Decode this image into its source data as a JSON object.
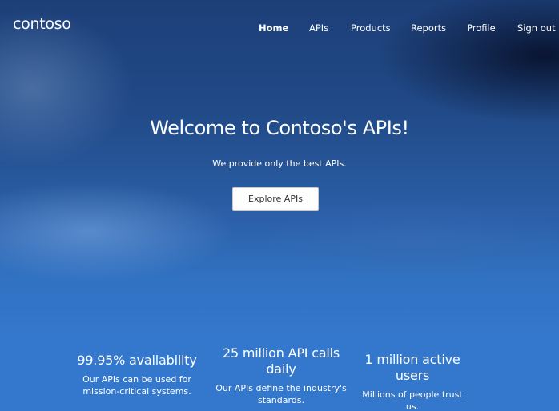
{
  "header": {
    "logo": "contoso",
    "nav": [
      {
        "label": "Home",
        "active": true
      },
      {
        "label": "APIs",
        "active": false
      },
      {
        "label": "Products",
        "active": false
      },
      {
        "label": "Reports",
        "active": false
      },
      {
        "label": "Profile",
        "active": false
      },
      {
        "label": "Sign out",
        "active": false
      }
    ]
  },
  "hero": {
    "title": "Welcome to Contoso's APIs!",
    "subtitle": "We provide only the best APIs.",
    "cta_label": "Explore APIs"
  },
  "features": [
    {
      "title": "99.95% availability",
      "text": "Our APIs can be used for mission-critical systems."
    },
    {
      "title": "25 million API calls daily",
      "text": "Our APIs define the industry's standards."
    },
    {
      "title": "1 million active users",
      "text": "Millions of people trust us."
    }
  ],
  "colors": {
    "hero_dark": "#1d3f78",
    "hero_light": "#3478cd",
    "text": "#ffffff",
    "button_bg": "#ffffff",
    "button_text": "#333333"
  }
}
